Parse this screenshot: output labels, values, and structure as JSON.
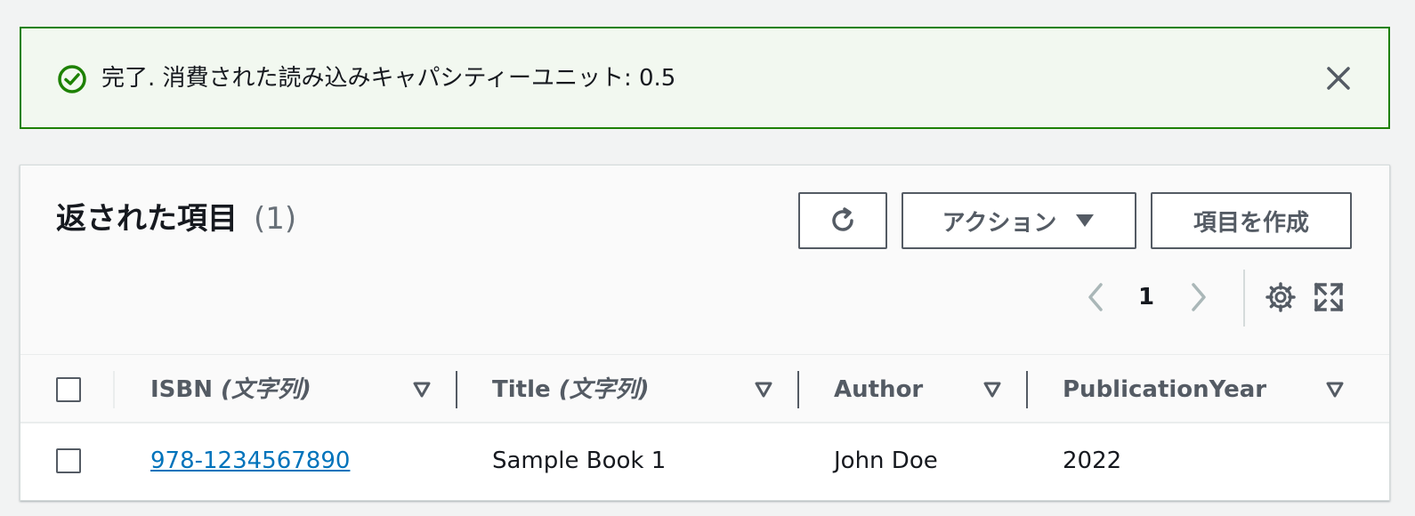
{
  "flash": {
    "message": "完了. 消費された読み込みキャパシティーユニット: 0.5",
    "icon": "check-circle-icon",
    "close_icon": "close-icon",
    "color": "#1d8102"
  },
  "panel": {
    "title": "返された項目",
    "count": "(1)",
    "actions_label": "アクション",
    "create_label": "項目を作成",
    "refresh_icon": "refresh-icon"
  },
  "pagination": {
    "current_page": "1"
  },
  "table": {
    "columns": [
      {
        "name": "ISBN",
        "type": "(文字列)"
      },
      {
        "name": "Title",
        "type": "(文字列)"
      },
      {
        "name": "Author",
        "type": ""
      },
      {
        "name": "PublicationYear",
        "type": ""
      }
    ],
    "rows": [
      {
        "isbn": "978-1234567890",
        "title": "Sample Book 1",
        "author": "John Doe",
        "year": "2022"
      }
    ]
  },
  "colors": {
    "link": "#0073bb",
    "border_dark": "#545b64",
    "success": "#1d8102"
  }
}
